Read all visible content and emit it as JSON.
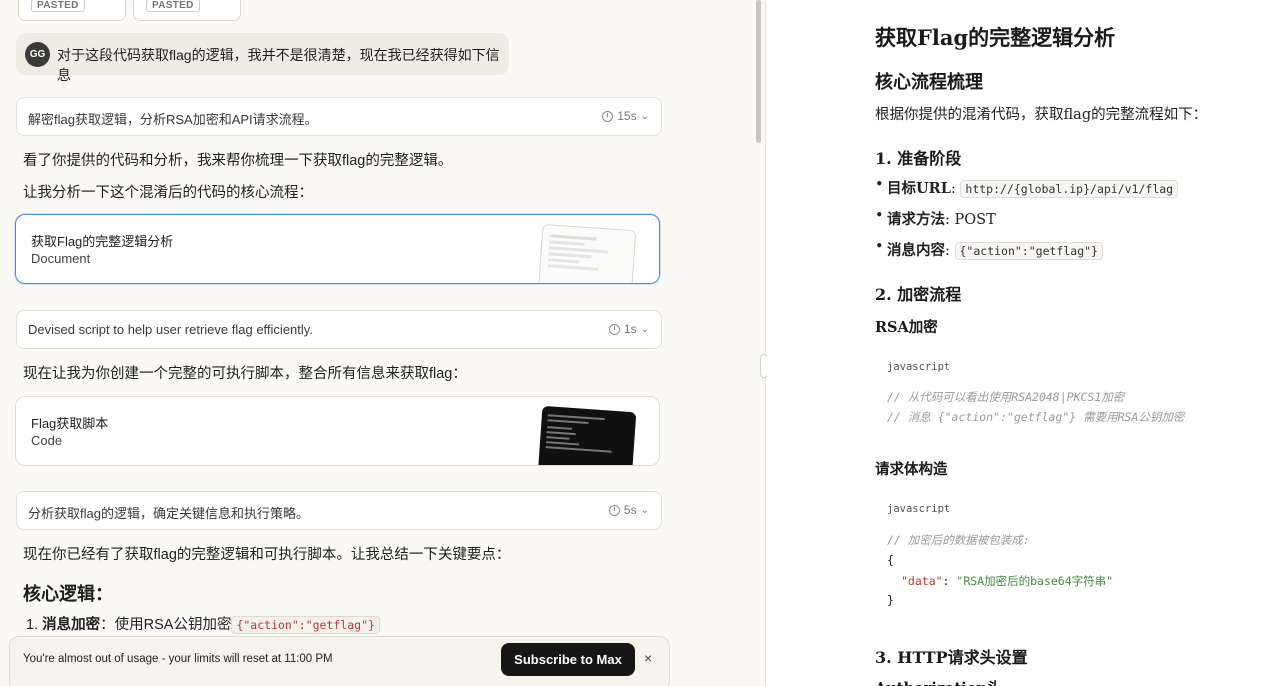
{
  "attachments": [
    {
      "badge": "PASTED"
    },
    {
      "badge": "PASTED"
    }
  ],
  "user_message": {
    "avatar": "GG",
    "text": "对于这段代码获取flag的逻辑，我并不是很清楚，现在我已经获得如下信息"
  },
  "thinking": [
    {
      "text": "解密flag获取逻辑，分析RSA加密和API请求流程。",
      "time": "15s"
    },
    {
      "text": "Devised script to help user retrieve flag efficiently.",
      "time": "1s"
    },
    {
      "text": "分析获取flag的逻辑，确定关键信息和执行策略。",
      "time": "5s"
    }
  ],
  "paragraphs": {
    "p1": "看了你提供的代码和分析，我来帮你梳理一下获取flag的完整逻辑。",
    "p2": "让我分析一下这个混淆后的代码的核心流程：",
    "p3": "现在让我为你创建一个完整的可执行脚本，整合所有信息来获取flag：",
    "p4": "现在你已经有了获取flag的完整逻辑和可执行脚本。让我总结一下关键要点："
  },
  "artifacts": [
    {
      "title": "获取Flag的完整逻辑分析",
      "type": "Document"
    },
    {
      "title": "Flag获取脚本",
      "type": "Code"
    }
  ],
  "summary": {
    "heading": "核心逻辑：",
    "item1_num": "1.",
    "item1_bold": "消息加密",
    "item1_text": "：使用RSA公钥加密",
    "item1_code": "{\"action\":\"getflag\"}"
  },
  "usage_notice": {
    "text": "You're almost out of usage - your limits will reset at 11:00 PM",
    "button": "Subscribe to Max",
    "close": "×"
  },
  "document": {
    "title": "获取Flag的完整逻辑分析",
    "h_flow": "核心流程梳理",
    "intro": "根据你提供的混淆代码，获取flag的完整流程如下：",
    "s1": "1. 准备阶段",
    "b1_label": "目标URL",
    "b1_code": "http://{global.ip}/api/v1/flag",
    "b2_label": "请求方法",
    "b2_value": "POST",
    "b3_label": "消息内容",
    "b3_code": "{\"action\":\"getflag\"}",
    "s2": "2. 加密流程",
    "rsa": "RSA加密",
    "lang1": "javascript",
    "c1": "// 从代码可以看出使用RSA2048|PKCS1加密",
    "c2": "// 消息 {\"action\":\"getflag\"} 需要用RSA公钥加密",
    "body": "请求体构造",
    "lang2": "javascript",
    "c3": "// 加密后的数据被包装成:",
    "brace_open": "{",
    "data_key": "\"data\"",
    "data_colon": ": ",
    "data_val": "\"RSA加密后的base64字符串\"",
    "brace_close": "}",
    "s3": "3. HTTP请求头设置",
    "auth": "Authorization头"
  }
}
